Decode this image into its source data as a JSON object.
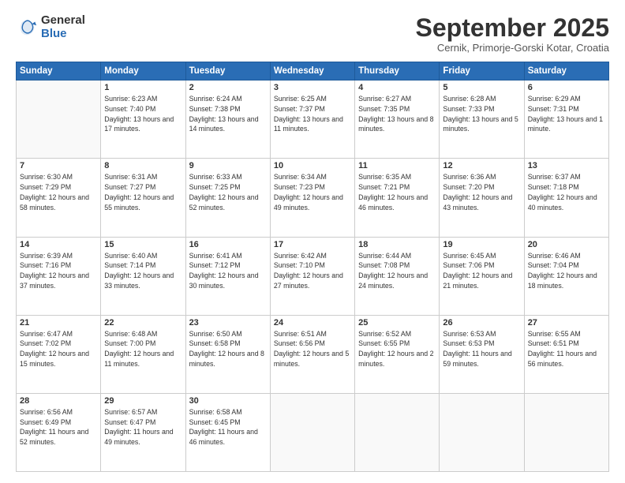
{
  "logo": {
    "general": "General",
    "blue": "Blue"
  },
  "title": "September 2025",
  "subtitle": "Cernik, Primorje-Gorski Kotar, Croatia",
  "weekdays": [
    "Sunday",
    "Monday",
    "Tuesday",
    "Wednesday",
    "Thursday",
    "Friday",
    "Saturday"
  ],
  "weeks": [
    [
      {
        "day": null,
        "info": null
      },
      {
        "day": "1",
        "info": "Sunrise: 6:23 AM\nSunset: 7:40 PM\nDaylight: 13 hours\nand 17 minutes."
      },
      {
        "day": "2",
        "info": "Sunrise: 6:24 AM\nSunset: 7:38 PM\nDaylight: 13 hours\nand 14 minutes."
      },
      {
        "day": "3",
        "info": "Sunrise: 6:25 AM\nSunset: 7:37 PM\nDaylight: 13 hours\nand 11 minutes."
      },
      {
        "day": "4",
        "info": "Sunrise: 6:27 AM\nSunset: 7:35 PM\nDaylight: 13 hours\nand 8 minutes."
      },
      {
        "day": "5",
        "info": "Sunrise: 6:28 AM\nSunset: 7:33 PM\nDaylight: 13 hours\nand 5 minutes."
      },
      {
        "day": "6",
        "info": "Sunrise: 6:29 AM\nSunset: 7:31 PM\nDaylight: 13 hours\nand 1 minute."
      }
    ],
    [
      {
        "day": "7",
        "info": "Sunrise: 6:30 AM\nSunset: 7:29 PM\nDaylight: 12 hours\nand 58 minutes."
      },
      {
        "day": "8",
        "info": "Sunrise: 6:31 AM\nSunset: 7:27 PM\nDaylight: 12 hours\nand 55 minutes."
      },
      {
        "day": "9",
        "info": "Sunrise: 6:33 AM\nSunset: 7:25 PM\nDaylight: 12 hours\nand 52 minutes."
      },
      {
        "day": "10",
        "info": "Sunrise: 6:34 AM\nSunset: 7:23 PM\nDaylight: 12 hours\nand 49 minutes."
      },
      {
        "day": "11",
        "info": "Sunrise: 6:35 AM\nSunset: 7:21 PM\nDaylight: 12 hours\nand 46 minutes."
      },
      {
        "day": "12",
        "info": "Sunrise: 6:36 AM\nSunset: 7:20 PM\nDaylight: 12 hours\nand 43 minutes."
      },
      {
        "day": "13",
        "info": "Sunrise: 6:37 AM\nSunset: 7:18 PM\nDaylight: 12 hours\nand 40 minutes."
      }
    ],
    [
      {
        "day": "14",
        "info": "Sunrise: 6:39 AM\nSunset: 7:16 PM\nDaylight: 12 hours\nand 37 minutes."
      },
      {
        "day": "15",
        "info": "Sunrise: 6:40 AM\nSunset: 7:14 PM\nDaylight: 12 hours\nand 33 minutes."
      },
      {
        "day": "16",
        "info": "Sunrise: 6:41 AM\nSunset: 7:12 PM\nDaylight: 12 hours\nand 30 minutes."
      },
      {
        "day": "17",
        "info": "Sunrise: 6:42 AM\nSunset: 7:10 PM\nDaylight: 12 hours\nand 27 minutes."
      },
      {
        "day": "18",
        "info": "Sunrise: 6:44 AM\nSunset: 7:08 PM\nDaylight: 12 hours\nand 24 minutes."
      },
      {
        "day": "19",
        "info": "Sunrise: 6:45 AM\nSunset: 7:06 PM\nDaylight: 12 hours\nand 21 minutes."
      },
      {
        "day": "20",
        "info": "Sunrise: 6:46 AM\nSunset: 7:04 PM\nDaylight: 12 hours\nand 18 minutes."
      }
    ],
    [
      {
        "day": "21",
        "info": "Sunrise: 6:47 AM\nSunset: 7:02 PM\nDaylight: 12 hours\nand 15 minutes."
      },
      {
        "day": "22",
        "info": "Sunrise: 6:48 AM\nSunset: 7:00 PM\nDaylight: 12 hours\nand 11 minutes."
      },
      {
        "day": "23",
        "info": "Sunrise: 6:50 AM\nSunset: 6:58 PM\nDaylight: 12 hours\nand 8 minutes."
      },
      {
        "day": "24",
        "info": "Sunrise: 6:51 AM\nSunset: 6:56 PM\nDaylight: 12 hours\nand 5 minutes."
      },
      {
        "day": "25",
        "info": "Sunrise: 6:52 AM\nSunset: 6:55 PM\nDaylight: 12 hours\nand 2 minutes."
      },
      {
        "day": "26",
        "info": "Sunrise: 6:53 AM\nSunset: 6:53 PM\nDaylight: 11 hours\nand 59 minutes."
      },
      {
        "day": "27",
        "info": "Sunrise: 6:55 AM\nSunset: 6:51 PM\nDaylight: 11 hours\nand 56 minutes."
      }
    ],
    [
      {
        "day": "28",
        "info": "Sunrise: 6:56 AM\nSunset: 6:49 PM\nDaylight: 11 hours\nand 52 minutes."
      },
      {
        "day": "29",
        "info": "Sunrise: 6:57 AM\nSunset: 6:47 PM\nDaylight: 11 hours\nand 49 minutes."
      },
      {
        "day": "30",
        "info": "Sunrise: 6:58 AM\nSunset: 6:45 PM\nDaylight: 11 hours\nand 46 minutes."
      },
      {
        "day": null,
        "info": null
      },
      {
        "day": null,
        "info": null
      },
      {
        "day": null,
        "info": null
      },
      {
        "day": null,
        "info": null
      }
    ]
  ]
}
